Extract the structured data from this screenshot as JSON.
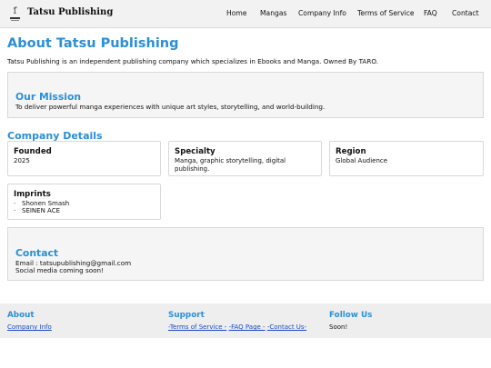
{
  "header": {
    "brand": "Tatsu Publishing",
    "nav": [
      "Home",
      "Mangas",
      "Company Info",
      "Terms of Service",
      "FAQ",
      "Contact"
    ]
  },
  "main": {
    "title": "About Tatsu Publishing",
    "intro": "Tatsu Publishing is an independent publishing company which specializes in Ebooks and Manga. Owned By TARO.",
    "mission": {
      "heading": "Our Mission",
      "text": "To deliver powerful manga experiences with unique art styles, storytelling, and world-building."
    },
    "details": {
      "heading": "Company Details",
      "founded": {
        "label": "Founded",
        "value": "2025"
      },
      "specialty": {
        "label": "Specialty",
        "value": "Manga, graphic storytelling, digital publishing."
      },
      "region": {
        "label": "Region",
        "value": "Global Audience"
      },
      "imprints": {
        "label": "Imprints",
        "items": [
          "Shonen Smash",
          "SEINEN ACE"
        ]
      }
    },
    "contact": {
      "heading": "Contact",
      "email": "Email : tatsupublishing@gmail.com",
      "social": "Social media coming soon!"
    }
  },
  "footer": {
    "about": {
      "heading": "About",
      "link": "Company Info"
    },
    "support": {
      "heading": "Support",
      "links": [
        "-Terms of Service -",
        "-FAQ Page -",
        "-Contact Us-"
      ]
    },
    "follow": {
      "heading": "Follow Us",
      "text": "Soon!"
    }
  },
  "colors": {
    "accent": "#2b8fd6",
    "link": "#1a47c9",
    "panel": "#f5f5f5"
  }
}
